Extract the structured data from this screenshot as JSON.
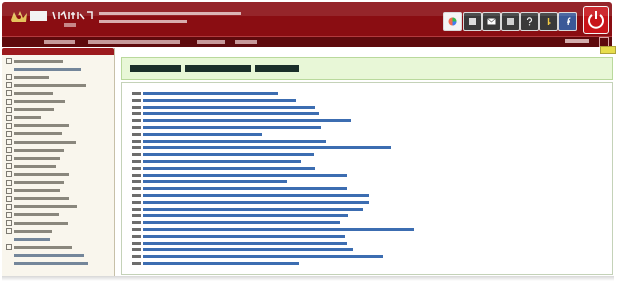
{
  "header": {
    "brand_mark": "upm-logo",
    "icons": [
      "color-wheel-icon",
      "user-profile-icon",
      "email-icon",
      "phone-icon",
      "help-icon",
      "key-icon",
      "facebook-icon",
      "power-icon"
    ]
  },
  "sidebar": {
    "menu_title": ""
  },
  "main": {
    "page_title": ""
  }
}
